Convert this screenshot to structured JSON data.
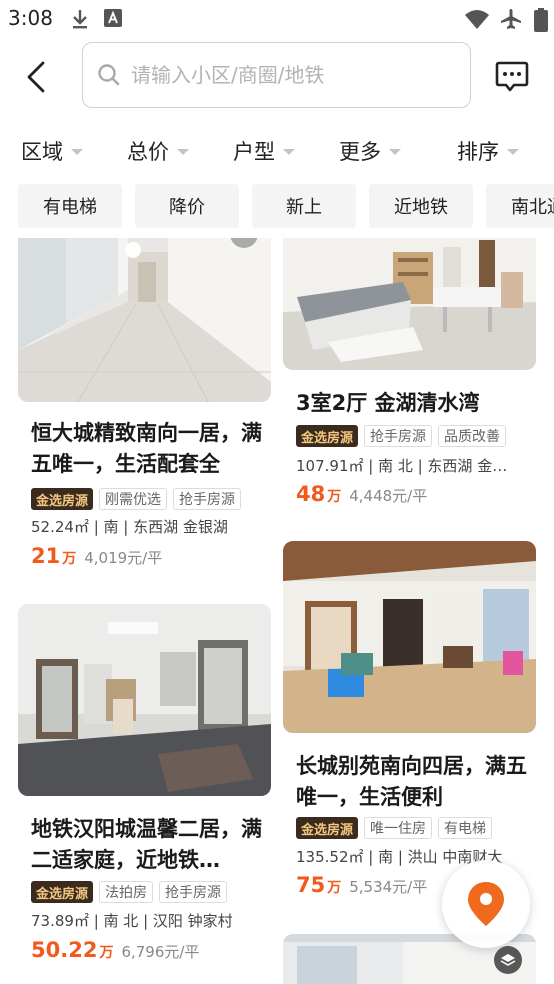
{
  "status_bar": {
    "time": "3:08"
  },
  "search": {
    "placeholder": "请输入小区/商圈/地铁"
  },
  "filters": [
    "区域",
    "总价",
    "户型",
    "更多",
    "排序"
  ],
  "chips": [
    "有电梯",
    "降价",
    "新上",
    "近地铁",
    "南北通"
  ],
  "colors": {
    "accent": "#f25a1d",
    "gold_tag_bg": "#3b2b1f",
    "gold_tag_text": "#f3c77f",
    "location_pin": "#f06a1e"
  },
  "listings": [
    {
      "title": "恒大城精致南向一居，满五唯一，生活配套全",
      "tags": [
        "金选房源",
        "刚需优选",
        "抢手房源"
      ],
      "meta": "52.24㎡ | 南 | 东西湖 金银湖",
      "price": "21",
      "price_unit": "万",
      "unit_price": "4,019元/平"
    },
    {
      "title": "3室2厅 金湖清水湾",
      "tags": [
        "金选房源",
        "抢手房源",
        "品质改善"
      ],
      "meta": "107.91㎡ | 南 北 | 东西湖 金…",
      "price": "48",
      "price_unit": "万",
      "unit_price": "4,448元/平"
    },
    {
      "title": "地铁汉阳城温馨二居，满二适家庭，近地铁…",
      "tags": [
        "金选房源",
        "法拍房",
        "抢手房源"
      ],
      "meta": "73.89㎡ | 南 北 | 汉阳 钟家村",
      "price": "50.22",
      "price_unit": "万",
      "unit_price": "6,796元/平"
    },
    {
      "title": "长城别苑南向四居，满五唯一，生活便利",
      "tags": [
        "金选房源",
        "唯一住房",
        "有电梯"
      ],
      "meta": "135.52㎡ | 南 | 洪山 中南财大",
      "price": "75",
      "price_unit": "万",
      "unit_price": "5,534元/平"
    }
  ]
}
